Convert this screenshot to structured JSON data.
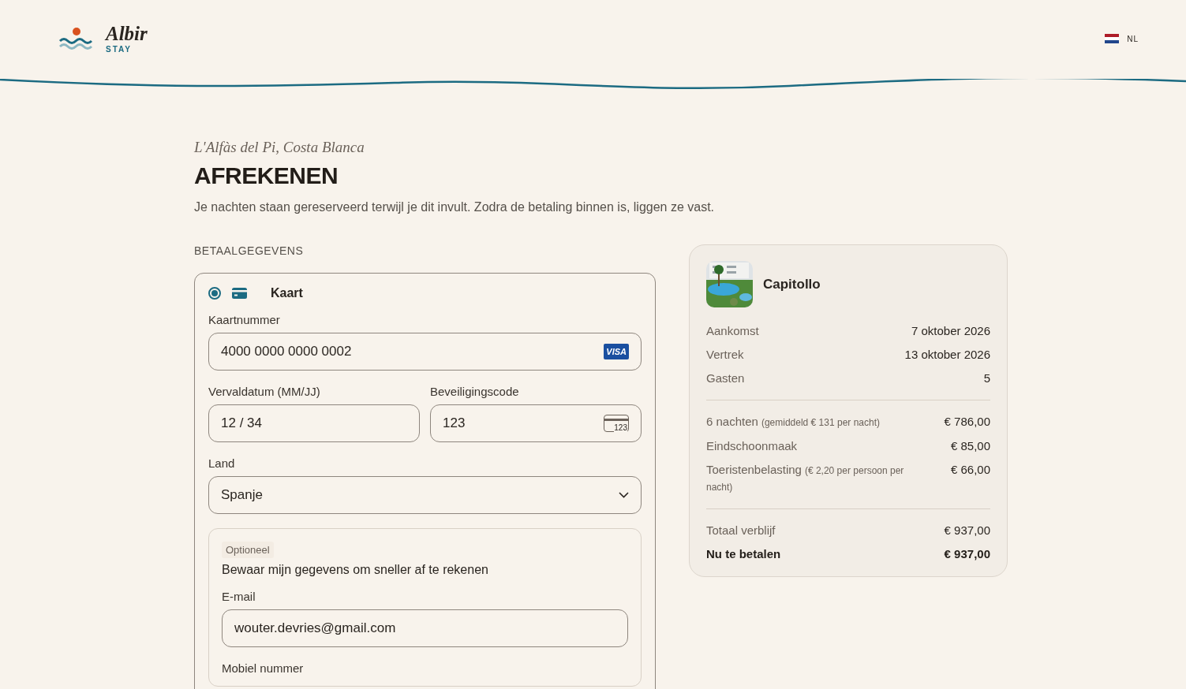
{
  "brand": {
    "name": "Albir",
    "tagline": "STAY"
  },
  "language": {
    "code": "NL"
  },
  "location": "L'Alfàs del Pi, Costa Blanca",
  "title": "AFREKENEN",
  "subtitle": "Je nachten staan gereserveerd terwijl je dit invult. Zodra de betaling binnen is, liggen ze vast.",
  "payment": {
    "section_label": "BETAALGEGEVENS",
    "method": {
      "label": "Kaart",
      "selected": true
    },
    "card_number": {
      "label": "Kaartnummer",
      "value": "4000 0000 0000 0002",
      "brand": "VISA"
    },
    "expiry": {
      "label": "Vervaldatum (MM/JJ)",
      "value": "12 / 34"
    },
    "security_code": {
      "label": "Beveiligingscode",
      "value": "123",
      "icon_text": "123"
    },
    "country": {
      "label": "Land",
      "value": "Spanje"
    },
    "save_details": {
      "badge": "Optioneel",
      "title": "Bewaar mijn gegevens om sneller af te rekenen",
      "email": {
        "label": "E-mail",
        "value": "wouter.devries@gmail.com"
      },
      "phone": {
        "label": "Mobiel nummer"
      }
    }
  },
  "summary": {
    "property": "Capitollo",
    "details": [
      {
        "label": "Aankomst",
        "value": "7 oktober 2026"
      },
      {
        "label": "Vertrek",
        "value": "13 oktober 2026"
      },
      {
        "label": "Gasten",
        "value": "5"
      }
    ],
    "costs": [
      {
        "label": "6 nachten",
        "note": "(gemiddeld € 131 per nacht)",
        "value": "€ 786,00"
      },
      {
        "label": "Eindschoonmaak",
        "value": "€ 85,00"
      },
      {
        "label": "Toeristenbelasting",
        "note": "(€ 2,20 per persoon per nacht)",
        "value": "€ 66,00"
      }
    ],
    "totals": [
      {
        "label": "Totaal verblijf",
        "value": "€ 937,00",
        "emphasis": false
      },
      {
        "label": "Nu te betalen",
        "value": "€ 937,00",
        "emphasis": true
      }
    ]
  }
}
